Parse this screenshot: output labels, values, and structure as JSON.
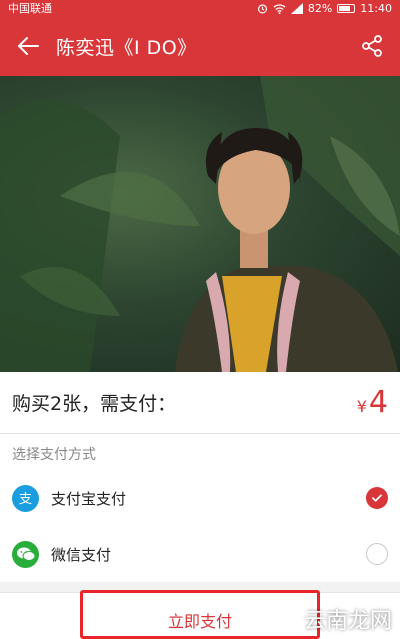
{
  "status_bar": {
    "carrier": "中国联通",
    "battery_text": "82%",
    "time": "11:40"
  },
  "header": {
    "title": "陈奕迅《I DO》",
    "back_icon": "arrow-left-icon",
    "share_icon": "share-icon"
  },
  "purchase": {
    "label": "购买2张，需支付：",
    "currency": "¥",
    "amount": "4"
  },
  "payment": {
    "section_title": "选择支付方式",
    "options": [
      {
        "label": "支付宝支付",
        "icon": "alipay-icon",
        "selected": true,
        "color": "#1a9ee0"
      },
      {
        "label": "微信支付",
        "icon": "wechat-icon",
        "selected": false,
        "color": "#2aae3b"
      }
    ]
  },
  "footer": {
    "pay_button_label": "立即支付"
  },
  "watermark": "云南龙网",
  "colors": {
    "accent": "#d9363a",
    "highlight_border": "#e8262a"
  }
}
